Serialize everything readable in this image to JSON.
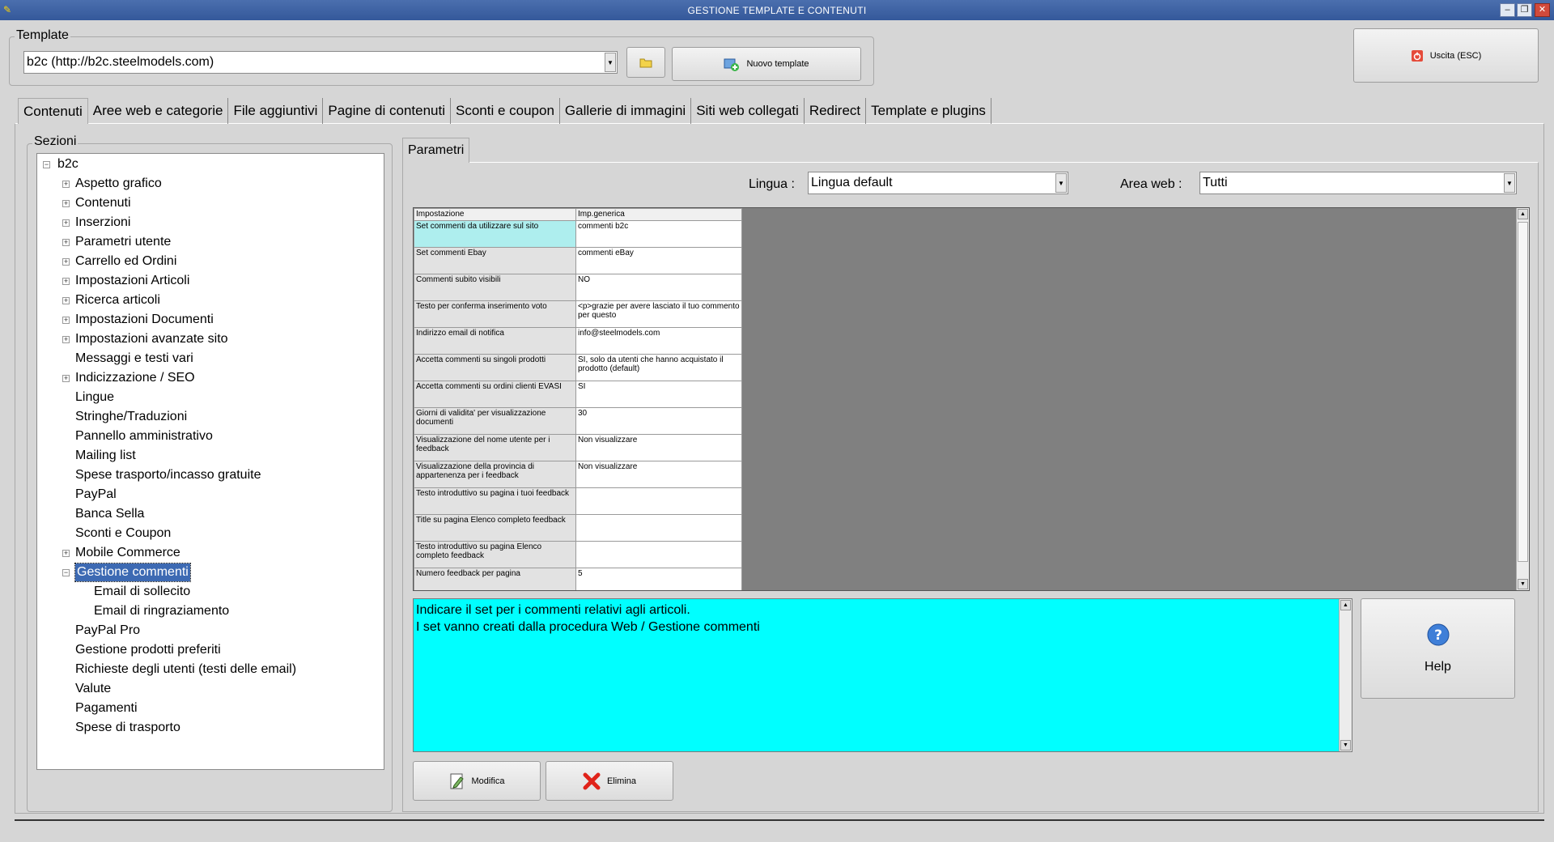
{
  "window": {
    "title": "GESTIONE TEMPLATE E CONTENUTI"
  },
  "template": {
    "legend": "Template",
    "selected": "b2c (http://b2c.steelmodels.com)",
    "new_button": "Nuovo template",
    "exit_button": "Uscita (ESC)"
  },
  "tabs": [
    "Contenuti",
    "Aree web e categorie",
    "File aggiuntivi",
    "Pagine di contenuti",
    "Sconti e coupon",
    "Gallerie di immagini",
    "Siti web collegati",
    "Redirect",
    "Template e plugins"
  ],
  "sections": {
    "legend": "Sezioni",
    "root": "b2c",
    "items": [
      {
        "label": "Aspetto grafico",
        "expander": "+"
      },
      {
        "label": "Contenuti",
        "expander": "+"
      },
      {
        "label": "Inserzioni",
        "expander": "+"
      },
      {
        "label": "Parametri utente",
        "expander": "+"
      },
      {
        "label": "Carrello ed Ordini",
        "expander": "+"
      },
      {
        "label": "Impostazioni Articoli",
        "expander": "+"
      },
      {
        "label": "Ricerca articoli",
        "expander": "+"
      },
      {
        "label": "Impostazioni Documenti",
        "expander": "+"
      },
      {
        "label": "Impostazioni avanzate sito",
        "expander": "+"
      },
      {
        "label": "Messaggi e testi vari",
        "expander": ""
      },
      {
        "label": "Indicizzazione / SEO",
        "expander": "+"
      },
      {
        "label": "Lingue",
        "expander": ""
      },
      {
        "label": "Stringhe/Traduzioni",
        "expander": ""
      },
      {
        "label": "Pannello amministrativo",
        "expander": ""
      },
      {
        "label": "Mailing list",
        "expander": ""
      },
      {
        "label": "Spese trasporto/incasso gratuite",
        "expander": ""
      },
      {
        "label": "PayPal",
        "expander": ""
      },
      {
        "label": "Banca Sella",
        "expander": ""
      },
      {
        "label": "Sconti e Coupon",
        "expander": ""
      },
      {
        "label": "Mobile Commerce",
        "expander": "+"
      },
      {
        "label": "Gestione commenti",
        "expander": "−",
        "selected": true
      },
      {
        "label": "Email di sollecito",
        "expander": "",
        "child": true
      },
      {
        "label": "Email di ringraziamento",
        "expander": "",
        "child": true
      },
      {
        "label": "PayPal Pro",
        "expander": ""
      },
      {
        "label": "Gestione prodotti preferiti",
        "expander": ""
      },
      {
        "label": "Richieste degli utenti (testi delle email)",
        "expander": ""
      },
      {
        "label": "Valute",
        "expander": ""
      },
      {
        "label": "Pagamenti",
        "expander": ""
      },
      {
        "label": "Spese di trasporto",
        "expander": ""
      }
    ]
  },
  "params": {
    "tab": "Parametri",
    "lingua_label": "Lingua :",
    "lingua_value": "Lingua default",
    "area_label": "Area web :",
    "area_value": "Tutti",
    "columns": [
      "Impostazione",
      "Imp.generica"
    ],
    "rows": [
      [
        "Set commenti da utilizzare sul sito",
        "commenti b2c"
      ],
      [
        "Set commenti Ebay",
        "commenti eBay"
      ],
      [
        "Commenti subito visibili",
        "NO"
      ],
      [
        "Testo per conferma inserimento voto",
        "<p>grazie per avere lasciato il tuo commento per questo"
      ],
      [
        "Indirizzo email di notifica",
        "info@steelmodels.com"
      ],
      [
        "Accetta commenti su singoli prodotti",
        "SI, solo da utenti che hanno acquistato il prodotto (default)"
      ],
      [
        "Accetta commenti su ordini clienti EVASI",
        "SI"
      ],
      [
        "Giorni di validita' per visualizzazione documenti",
        "30"
      ],
      [
        "Visualizzazione del nome utente per i feedback",
        "Non visualizzare"
      ],
      [
        "Visualizzazione della provincia di appartenenza per i feedback",
        "Non visualizzare"
      ],
      [
        "Testo introduttivo su pagina i tuoi feedback",
        ""
      ],
      [
        "Title su pagina Elenco completo feedback",
        ""
      ],
      [
        "Testo introduttivo su pagina Elenco completo feedback",
        ""
      ],
      [
        "Numero feedback per pagina",
        "5"
      ]
    ],
    "description": "Indicare il set per i commenti relativi agli articoli.\nI set vanno creati dalla procedura Web / Gestione commenti",
    "help": "Help",
    "edit": "Modifica",
    "delete": "Elimina"
  },
  "colors": {
    "titlebar": "#3c5fa0",
    "description_bg": "#00ffff",
    "selected_row": "#aeeeee",
    "tree_selection": "#3d6ab3"
  }
}
